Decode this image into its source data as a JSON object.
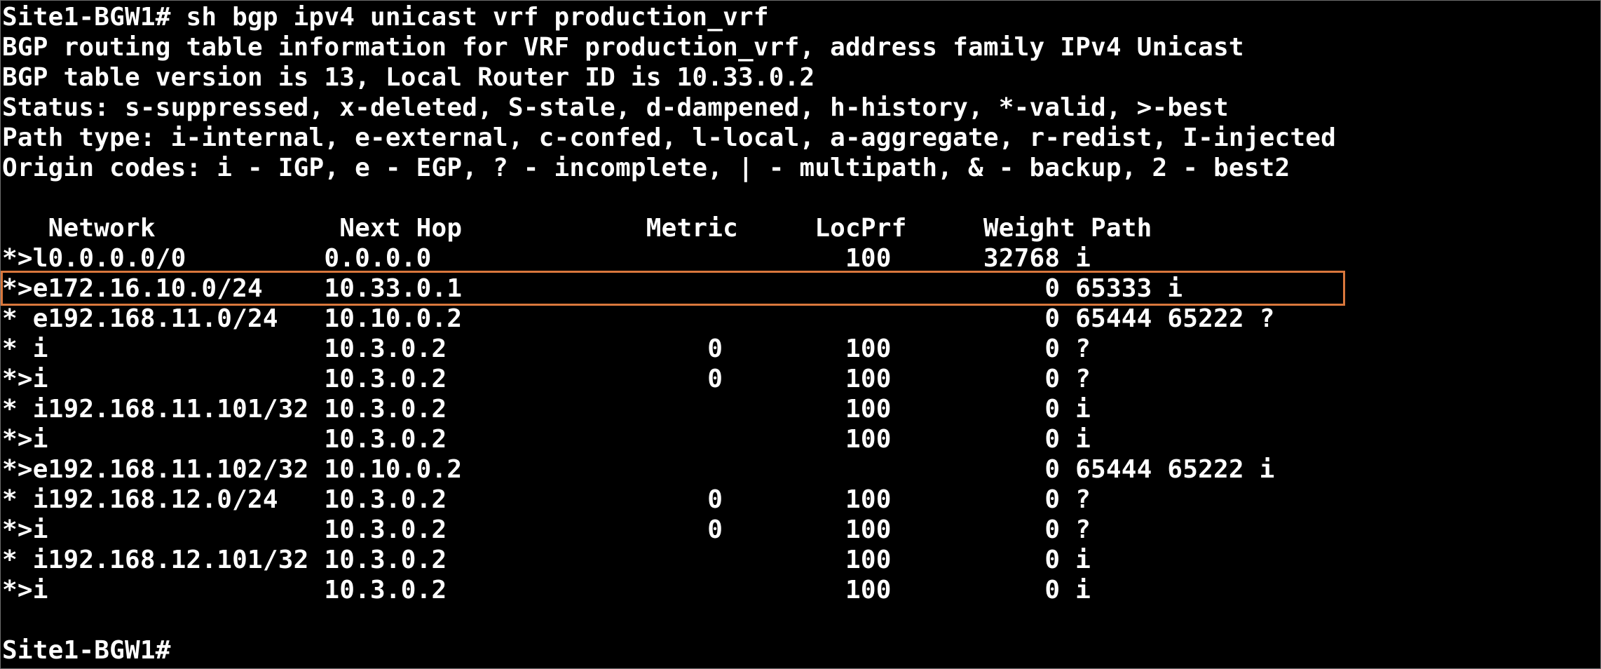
{
  "terminal": {
    "lines": [
      "Site1-BGW1# sh bgp ipv4 unicast vrf production_vrf",
      "BGP routing table information for VRF production_vrf, address family IPv4 Unicast",
      "BGP table version is 13, Local Router ID is 10.33.0.2",
      "Status: s-suppressed, x-deleted, S-stale, d-dampened, h-history, *-valid, >-best",
      "Path type: i-internal, e-external, c-confed, l-local, a-aggregate, r-redist, I-injected",
      "Origin codes: i - IGP, e - EGP, ? - incomplete, | - multipath, & - backup, 2 - best2",
      "",
      "   Network            Next Hop            Metric     LocPrf     Weight Path",
      "*>l0.0.0.0/0         0.0.0.0                           100      32768 i",
      "*>e172.16.10.0/24    10.33.0.1                                      0 65333 i",
      "* e192.168.11.0/24   10.10.0.2                                      0 65444 65222 ?",
      "* i                  10.3.0.2                 0        100          0 ?",
      "*>i                  10.3.0.2                 0        100          0 ?",
      "* i192.168.11.101/32 10.3.0.2                          100          0 i",
      "*>i                  10.3.0.2                          100          0 i",
      "*>e192.168.11.102/32 10.10.0.2                                      0 65444 65222 i",
      "* i192.168.12.0/24   10.3.0.2                 0        100          0 ?",
      "*>i                  10.3.0.2                 0        100          0 ?",
      "* i192.168.12.101/32 10.3.0.2                          100          0 i",
      "*>i                  10.3.0.2                          100          0 i",
      "",
      "Site1-BGW1#"
    ]
  },
  "colors": {
    "background": "#000000",
    "text": "#ffffff",
    "highlight": "#d9773c"
  }
}
